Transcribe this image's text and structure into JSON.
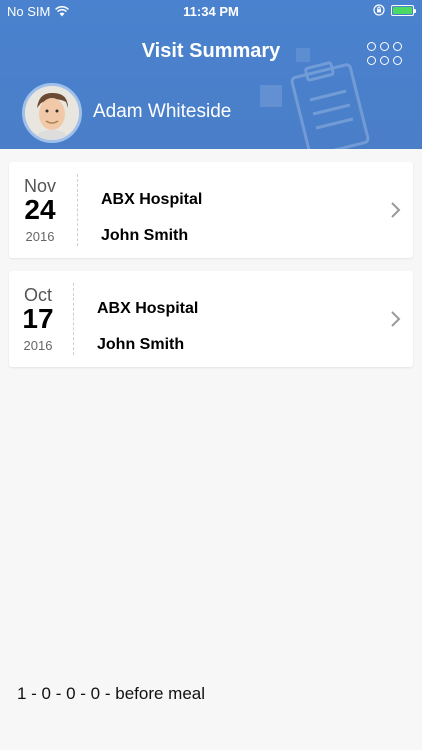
{
  "status_bar": {
    "carrier": "No SIM",
    "time": "11:34 PM",
    "wifi_icon": "wifi-icon",
    "lock_icon": "orientation-lock-icon",
    "battery_icon": "battery-icon",
    "battery_color": "#4cd964"
  },
  "header": {
    "title": "Visit Summary",
    "menu_icon": "grid-menu-icon",
    "background_color": "#4a82cf"
  },
  "profile": {
    "name": "Adam Whiteside"
  },
  "visits": [
    {
      "month": "Nov",
      "day": "24",
      "year": "2016",
      "hospital": "ABX Hospital",
      "doctor": "John Smith"
    },
    {
      "month": "Oct",
      "day": "17",
      "year": "2016",
      "hospital": "ABX Hospital",
      "doctor": "John Smith"
    }
  ],
  "footer": {
    "note": "1 - 0 - 0 - 0 - before meal"
  }
}
